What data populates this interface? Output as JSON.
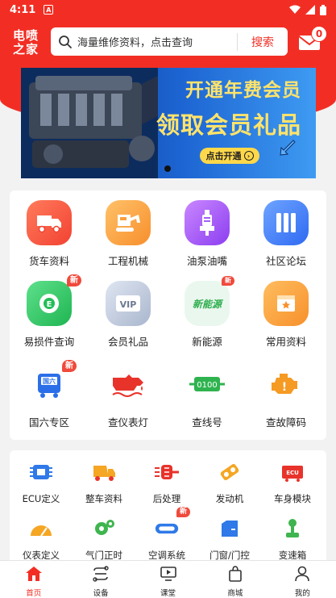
{
  "status_bar": {
    "time": "4:11",
    "app_glyph": "A"
  },
  "header": {
    "logo_line1": "电喷",
    "logo_line2": "之家",
    "search_placeholder": "海量维修资料，点击查询",
    "search_button": "搜索",
    "message_count": "0"
  },
  "banner": {
    "line1": "开通年费会员",
    "line2": "领取会员礼品",
    "cta": "点击开通"
  },
  "main_grid": [
    {
      "label": "货车资料",
      "icon": "truck-icon"
    },
    {
      "label": "工程机械",
      "icon": "excavator-icon"
    },
    {
      "label": "油泵油嘴",
      "icon": "fuel-pump-icon"
    },
    {
      "label": "社区论坛",
      "icon": "forum-icon"
    },
    {
      "label": "易损件查询",
      "icon": "parts-search-icon",
      "tag": "新"
    },
    {
      "label": "会员礼品",
      "icon": "vip-icon"
    },
    {
      "label": "新能源",
      "icon": "new-energy-icon",
      "tag": "新",
      "icon_text": "新能源"
    },
    {
      "label": "常用资料",
      "icon": "star-folder-icon"
    },
    {
      "label": "国六专区",
      "icon": "bus-icon",
      "tag": "新",
      "icon_text": "国六"
    },
    {
      "label": "查仪表灯",
      "icon": "oil-lamp-icon"
    },
    {
      "label": "查线号",
      "icon": "wire-number-icon",
      "icon_text": "0100"
    },
    {
      "label": "查故障码",
      "icon": "engine-fault-icon"
    }
  ],
  "sub_grid": [
    {
      "label": "ECU定义",
      "icon": "ecu-icon"
    },
    {
      "label": "整车资料",
      "icon": "dump-truck-icon"
    },
    {
      "label": "后处理",
      "icon": "aftertreatment-icon"
    },
    {
      "label": "发动机",
      "icon": "engine-icon"
    },
    {
      "label": "车身模块",
      "icon": "body-module-icon",
      "icon_text": "ECU"
    },
    {
      "label": "仪表定义",
      "icon": "gauge-icon"
    },
    {
      "label": "气门正时",
      "icon": "gear-icon"
    },
    {
      "label": "空调系统",
      "icon": "ac-icon",
      "tag": "新"
    },
    {
      "label": "门窗/门控",
      "icon": "door-icon"
    },
    {
      "label": "变速箱",
      "icon": "gear-shift-icon"
    }
  ],
  "tabbar": [
    {
      "label": "首页",
      "icon": "home-icon"
    },
    {
      "label": "设备",
      "icon": "device-icon"
    },
    {
      "label": "课堂",
      "icon": "classroom-icon"
    },
    {
      "label": "商城",
      "icon": "shop-icon"
    },
    {
      "label": "我的",
      "icon": "profile-icon"
    }
  ],
  "colors": {
    "brand_red": "#f22e24",
    "badge_red": "#f04a3c",
    "banner_gold": "#ffe36b"
  }
}
